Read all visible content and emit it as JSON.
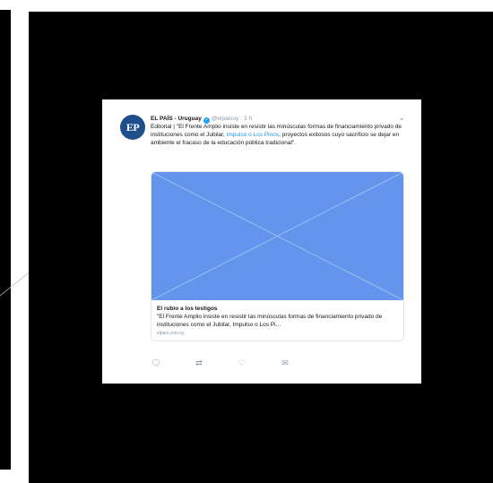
{
  "tweet": {
    "avatar_text": "EP",
    "author_name": "EL PAÍS - Uruguay",
    "handle_time": "@elpaisuy · 3 h",
    "text_before_link": "Editorial | \"El Frente Amplio insiste en resistir las minúsculas formas de financiamiento privado de instituciones como el Jubilar, Impulso o Los Pinos, proyectos exitosos cuyo sacrificio se dejar en ambiente el fracaso de la educación pública tradicional\".",
    "link_text": "Impulso o Los Pinos",
    "caret": "⌄"
  },
  "card": {
    "title": "El rubio a los testigos",
    "description": "\"El Frente Amplio insiste en resistir las minúsculas formas de financiamiento privado de instituciones como el Jubilar, Impulso o Los Pi...",
    "domain": "elpais.com.uy"
  },
  "actions": {
    "reply": "🗨",
    "retweet": "⇄",
    "like": "♡",
    "message": "✉"
  },
  "colors": {
    "backdrop": "#000000",
    "card_image_fill": "#6495ed",
    "avatar": "#1f4e8c",
    "link": "#1b95e0"
  }
}
